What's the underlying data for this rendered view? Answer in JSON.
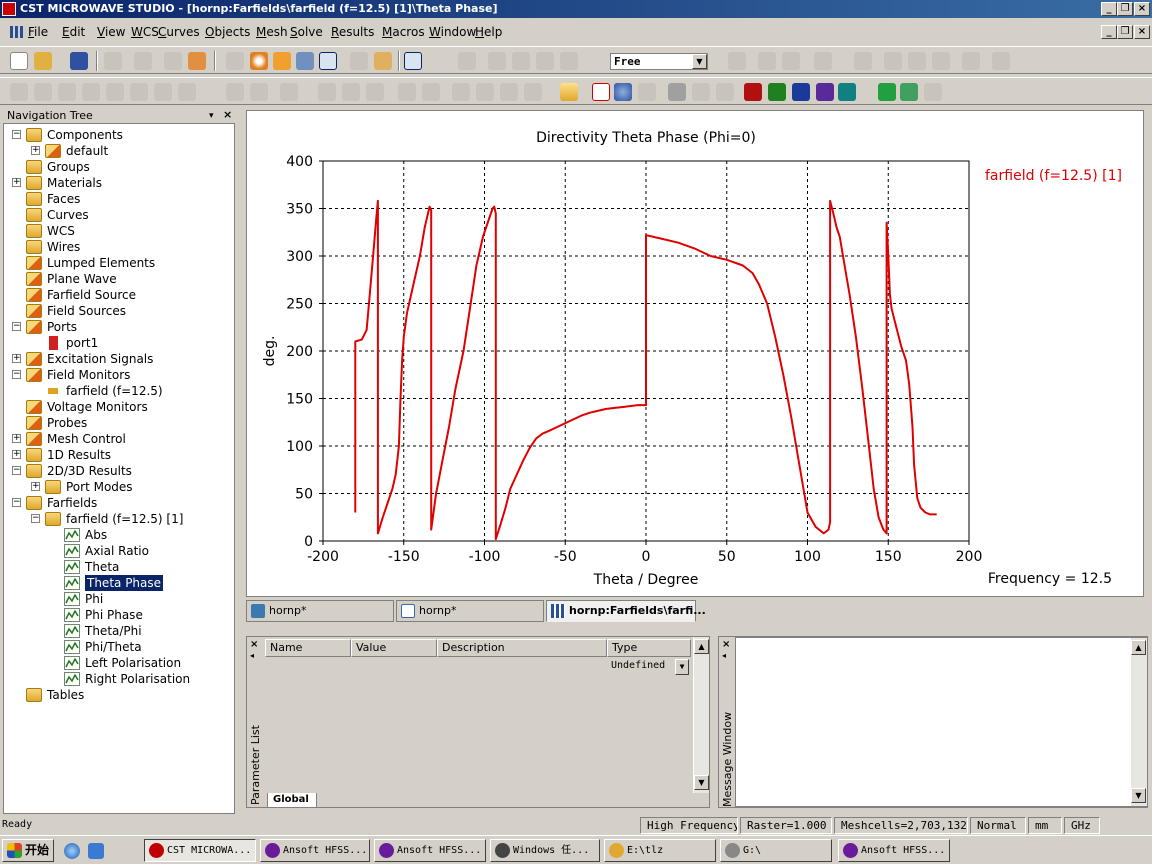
{
  "window": {
    "title": "CST MICROWAVE STUDIO - [hornp:Farfields\\farfield (f=12.5) [1]\\Theta Phase]"
  },
  "menu": [
    "File",
    "Edit",
    "View",
    "WCS",
    "Curves",
    "Objects",
    "Mesh",
    "Solve",
    "Results",
    "Macros",
    "Window",
    "Help"
  ],
  "toolbar": {
    "mode_select": "Free"
  },
  "nav": {
    "title": "Navigation Tree",
    "items": [
      {
        "label": "Components",
        "depth": 0,
        "exp": "-",
        "icon": "folder"
      },
      {
        "label": "default",
        "depth": 1,
        "exp": "+",
        "icon": "gear"
      },
      {
        "label": "Groups",
        "depth": 0,
        "exp": "",
        "icon": "folder"
      },
      {
        "label": "Materials",
        "depth": 0,
        "exp": "+",
        "icon": "folder"
      },
      {
        "label": "Faces",
        "depth": 0,
        "exp": "",
        "icon": "folder"
      },
      {
        "label": "Curves",
        "depth": 0,
        "exp": "",
        "icon": "folder"
      },
      {
        "label": "WCS",
        "depth": 0,
        "exp": "",
        "icon": "folder"
      },
      {
        "label": "Wires",
        "depth": 0,
        "exp": "",
        "icon": "folder"
      },
      {
        "label": "Lumped Elements",
        "depth": 0,
        "exp": "",
        "icon": "gear"
      },
      {
        "label": "Plane Wave",
        "depth": 0,
        "exp": "",
        "icon": "gear"
      },
      {
        "label": "Farfield Source",
        "depth": 0,
        "exp": "",
        "icon": "gear"
      },
      {
        "label": "Field Sources",
        "depth": 0,
        "exp": "",
        "icon": "gear"
      },
      {
        "label": "Ports",
        "depth": 0,
        "exp": "-",
        "icon": "gear"
      },
      {
        "label": "port1",
        "depth": 1,
        "exp": "",
        "icon": "port"
      },
      {
        "label": "Excitation Signals",
        "depth": 0,
        "exp": "+",
        "icon": "gear"
      },
      {
        "label": "Field Monitors",
        "depth": 0,
        "exp": "-",
        "icon": "gear"
      },
      {
        "label": "farfield (f=12.5)",
        "depth": 1,
        "exp": "",
        "icon": "monitor"
      },
      {
        "label": "Voltage Monitors",
        "depth": 0,
        "exp": "",
        "icon": "gear"
      },
      {
        "label": "Probes",
        "depth": 0,
        "exp": "",
        "icon": "gear"
      },
      {
        "label": "Mesh Control",
        "depth": 0,
        "exp": "+",
        "icon": "gear"
      },
      {
        "label": "1D Results",
        "depth": 0,
        "exp": "+",
        "icon": "folder"
      },
      {
        "label": "2D/3D Results",
        "depth": 0,
        "exp": "-",
        "icon": "folder"
      },
      {
        "label": "Port Modes",
        "depth": 1,
        "exp": "+",
        "icon": "folder"
      },
      {
        "label": "Farfields",
        "depth": 0,
        "exp": "-",
        "icon": "folder"
      },
      {
        "label": "farfield (f=12.5) [1]",
        "depth": 1,
        "exp": "-",
        "icon": "folder"
      },
      {
        "label": "Abs",
        "depth": 2,
        "exp": "",
        "icon": "plot"
      },
      {
        "label": "Axial Ratio",
        "depth": 2,
        "exp": "",
        "icon": "plot"
      },
      {
        "label": "Theta",
        "depth": 2,
        "exp": "",
        "icon": "plot"
      },
      {
        "label": "Theta Phase",
        "depth": 2,
        "exp": "",
        "icon": "plot",
        "selected": true
      },
      {
        "label": "Phi",
        "depth": 2,
        "exp": "",
        "icon": "plot"
      },
      {
        "label": "Phi Phase",
        "depth": 2,
        "exp": "",
        "icon": "plot"
      },
      {
        "label": "Theta/Phi",
        "depth": 2,
        "exp": "",
        "icon": "plot"
      },
      {
        "label": "Phi/Theta",
        "depth": 2,
        "exp": "",
        "icon": "plot"
      },
      {
        "label": "Left Polarisation",
        "depth": 2,
        "exp": "",
        "icon": "plot"
      },
      {
        "label": "Right Polarisation",
        "depth": 2,
        "exp": "",
        "icon": "plot"
      },
      {
        "label": "Tables",
        "depth": 0,
        "exp": "",
        "icon": "folder"
      }
    ]
  },
  "chart_data": {
    "type": "line",
    "title": "Directivity Theta Phase (Phi=0)",
    "xlabel": "Theta / Degree",
    "ylabel": "deg.",
    "xlim": [
      -200,
      200
    ],
    "ylim": [
      0,
      400
    ],
    "xticks": [
      -200,
      -150,
      -100,
      -50,
      0,
      50,
      100,
      150,
      200
    ],
    "yticks": [
      0,
      50,
      100,
      150,
      200,
      250,
      300,
      350,
      400
    ],
    "grid": true,
    "legend": "top-right",
    "color": "#e00000",
    "footer": "Frequency = 12.5",
    "series": [
      {
        "name": "farfield (f=12.5) [1]",
        "x": [
          -180,
          -180,
          -176,
          -173,
          -171,
          -169,
          -167,
          -166,
          -166,
          -163,
          -160,
          -157,
          -155,
          -153,
          -152,
          -151,
          -150,
          -148,
          -144,
          -140,
          -137,
          -135,
          -134,
          -133,
          -133,
          -130,
          -126,
          -122,
          -118,
          -113,
          -109,
          -105,
          -101,
          -97,
          -95,
          -94,
          -93,
          -93,
          -90,
          -87,
          -84,
          -80,
          -76,
          -72,
          -68,
          -64,
          -60,
          -55,
          -50,
          -45,
          -40,
          -35,
          -30,
          -25,
          -20,
          -15,
          -10,
          -5,
          0,
          0,
          10,
          20,
          30,
          40,
          50,
          60,
          66,
          70,
          75,
          80,
          85,
          90,
          95,
          100,
          105,
          110,
          113,
          114,
          114,
          116,
          118,
          120,
          123,
          126,
          130,
          134,
          138,
          141,
          144,
          147,
          149,
          149,
          150,
          151,
          152,
          155,
          158,
          161,
          163,
          165,
          166,
          168,
          170,
          173,
          176,
          180
        ],
        "y": [
          30,
          210,
          212,
          222,
          260,
          300,
          340,
          358,
          8,
          25,
          40,
          55,
          70,
          100,
          150,
          190,
          215,
          240,
          270,
          300,
          330,
          345,
          352,
          348,
          12,
          50,
          85,
          120,
          160,
          200,
          245,
          290,
          320,
          340,
          350,
          352,
          345,
          2,
          18,
          35,
          55,
          70,
          85,
          98,
          108,
          113,
          116,
          120,
          124,
          128,
          132,
          135,
          137,
          139,
          140,
          141,
          142,
          143,
          143,
          322,
          318,
          314,
          308,
          300,
          296,
          290,
          282,
          270,
          250,
          215,
          175,
          130,
          80,
          30,
          15,
          8,
          12,
          20,
          358,
          345,
          330,
          320,
          290,
          260,
          215,
          160,
          100,
          55,
          25,
          12,
          8,
          335,
          300,
          260,
          245,
          225,
          205,
          190,
          165,
          120,
          80,
          45,
          35,
          30,
          28,
          28
        ]
      }
    ]
  },
  "tabs": [
    {
      "label": "hornp*",
      "active": false
    },
    {
      "label": "hornp*",
      "active": false
    },
    {
      "label": "hornp:Farfields\\farfi...",
      "active": true
    }
  ],
  "params": {
    "columns": [
      "Name",
      "Value",
      "Description",
      "Type"
    ],
    "type_value": "Undefined",
    "side_label": "Parameter List",
    "sheet_tab": "Global"
  },
  "message": {
    "side_label": "Message Window"
  },
  "status": {
    "left": "Ready",
    "panes": [
      "High Frequency",
      "Raster=1.000",
      "Meshcells=2,703,132",
      "Normal",
      "mm",
      "GHz"
    ]
  },
  "taskbar": {
    "start": "开始",
    "buttons": [
      {
        "label": "CST MICROWA...",
        "active": true,
        "color": "#c00000"
      },
      {
        "label": "Ansoft HFSS...",
        "active": false,
        "color": "#6a1b9a"
      },
      {
        "label": "Ansoft HFSS...",
        "active": false,
        "color": "#6a1b9a"
      },
      {
        "label": "Windows 任...",
        "active": false,
        "color": "#444"
      },
      {
        "label": "E:\\tlz",
        "active": false,
        "color": "#e0a82e"
      },
      {
        "label": "G:\\",
        "active": false,
        "color": "#888"
      },
      {
        "label": "Ansoft HFSS...",
        "active": false,
        "color": "#6a1b9a"
      }
    ]
  }
}
